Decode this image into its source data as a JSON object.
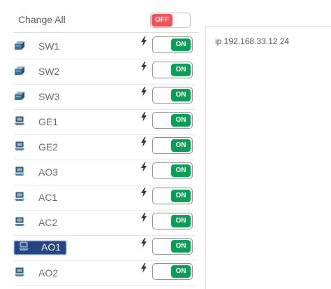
{
  "header": {
    "label": "Change All",
    "toggle_label": "OFF"
  },
  "devices": [
    {
      "name": "SW1",
      "type": "switch",
      "status": "ON"
    },
    {
      "name": "SW2",
      "type": "switch",
      "status": "ON"
    },
    {
      "name": "SW3",
      "type": "switch",
      "status": "ON"
    },
    {
      "name": "GE1",
      "type": "computer",
      "status": "ON"
    },
    {
      "name": "GE2",
      "type": "computer",
      "status": "ON"
    },
    {
      "name": "AO3",
      "type": "computer",
      "status": "ON"
    },
    {
      "name": "AC1",
      "type": "computer",
      "status": "ON"
    },
    {
      "name": "AC2",
      "type": "computer",
      "status": "ON"
    },
    {
      "name": "AO1",
      "type": "computer",
      "status": "ON",
      "selected": true
    },
    {
      "name": "AO2",
      "type": "computer",
      "status": "ON"
    }
  ],
  "config_panel": {
    "text": "ip 192.168.33.12 24"
  },
  "icons": {
    "switch": "network-switch-icon",
    "computer": "computer-icon",
    "power": "lightning-bolt-icon"
  },
  "colors": {
    "on": "#0a9d55",
    "off": "#f25157",
    "selected": "#24457f"
  }
}
